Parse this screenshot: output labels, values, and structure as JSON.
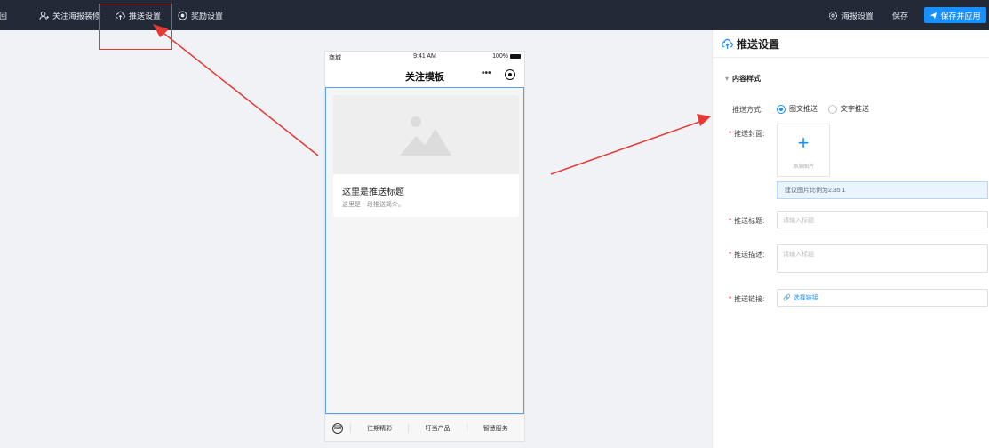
{
  "topbar": {
    "back": "返回",
    "nav_attention": "关注海报装修",
    "nav_push": "推送设置",
    "nav_reward": "奖励设置",
    "poster_settings": "海报设置",
    "save": "保存",
    "save_apply": "保存并应用",
    "accent": "#1890ff",
    "bg": "#222a38"
  },
  "phone": {
    "status_left": "商城",
    "time": "9:41 AM",
    "battery": "100%",
    "title": "关注模板",
    "card_title": "这里是推送标题",
    "card_desc": "这里是一段推送简介。",
    "tabs": [
      "往期精彩",
      "叮当产品",
      "智慧服务"
    ]
  },
  "panel": {
    "title": "推送设置",
    "section": "内容样式",
    "push_mode_label": "推送方式:",
    "push_mode_options": [
      "图文推送",
      "文字推送"
    ],
    "push_mode_selected": "图文推送",
    "cover_label": "推送封面:",
    "upload_caption": "添加图片",
    "cover_hint": "建议图片比例为2.35:1",
    "title_label": "推送标题:",
    "title_placeholder": "请输入标题",
    "desc_label": "推送描述:",
    "desc_placeholder": "请输入标题",
    "link_label": "推送链接:",
    "link_text": "选择链接"
  },
  "annotation_color": "#e53935"
}
